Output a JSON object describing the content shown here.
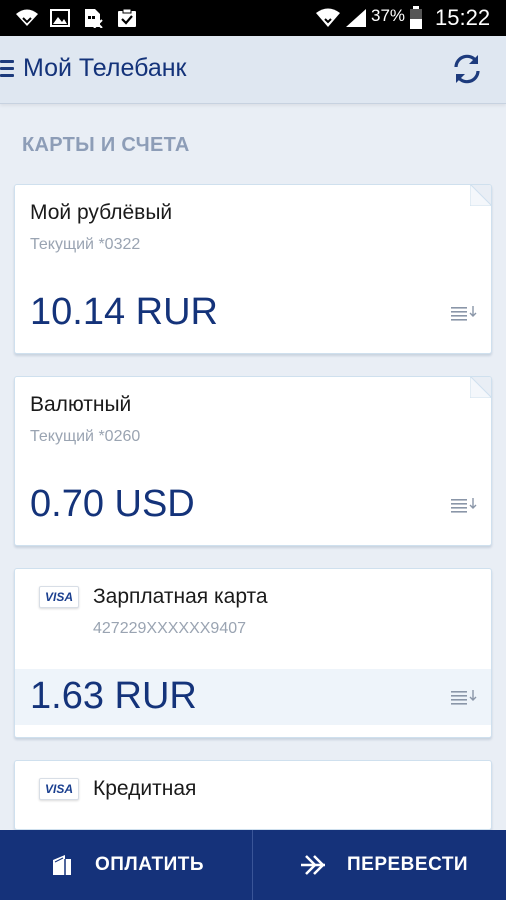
{
  "status_bar": {
    "battery_percent": "37%",
    "time": "15:22"
  },
  "app_bar": {
    "title": "Мой Телебанк"
  },
  "section": {
    "title": "КАРТЫ И СЧЕТА"
  },
  "accounts": [
    {
      "name": "Мой рублёвый",
      "subtitle": "Текущий *0322",
      "amount": "10.14 RUR"
    },
    {
      "name": "Валютный",
      "subtitle": "Текущий *0260",
      "amount": "0.70 USD"
    },
    {
      "name": "Зарплатная карта",
      "subtitle": "427229XXXXXX9407",
      "amount": "1.63 RUR",
      "brand": "VISA"
    },
    {
      "name": "Кредитная",
      "brand": "VISA"
    }
  ],
  "bottom_bar": {
    "pay_label": "ОПЛАТИТЬ",
    "transfer_label": "ПЕРЕВЕСТИ"
  },
  "colors": {
    "primary": "#14337a",
    "bottom_bar": "#15327a",
    "background": "#e9eef5"
  }
}
